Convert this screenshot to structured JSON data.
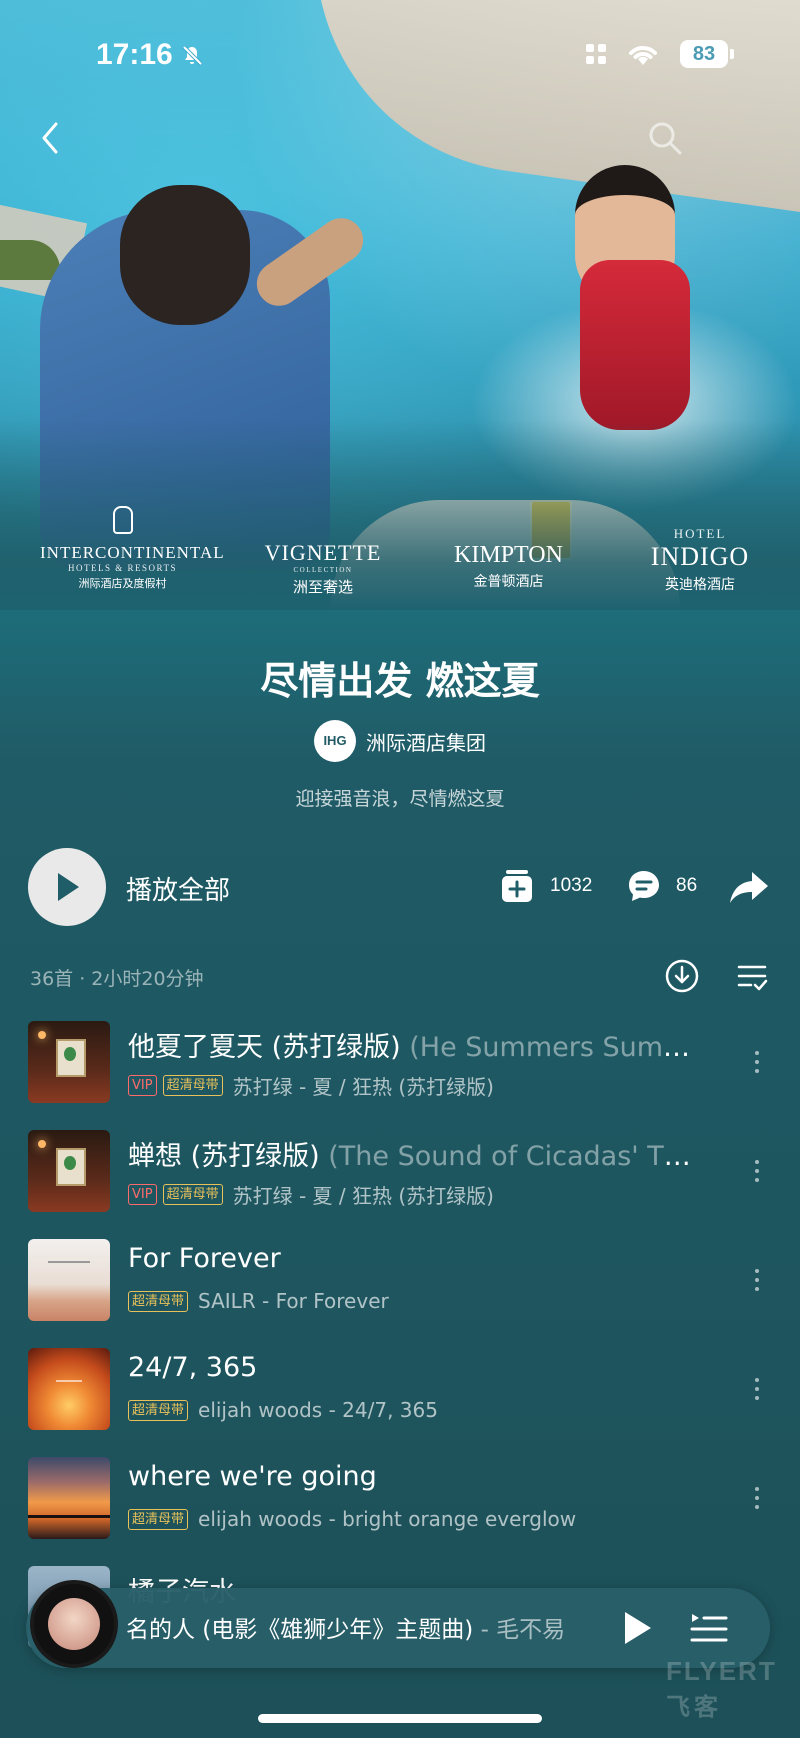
{
  "status_bar": {
    "time": "17:16",
    "battery": "83"
  },
  "hero": {
    "brands": [
      {
        "name": "INTERCONTINENTAL",
        "sub": "HOTELS & RESORTS",
        "cn": "洲际酒店及度假村"
      },
      {
        "name": "VIGNETTE",
        "sub": "COLLECTION",
        "cn": "洲至奢选"
      },
      {
        "name": "KIMPTON",
        "sub": "",
        "cn": "金普顿酒店"
      },
      {
        "name": "INDIGO",
        "sub": "HOTEL",
        "cn": "英迪格酒店"
      }
    ]
  },
  "playlist": {
    "title": "尽情出发 燃这夏",
    "publisher_logo": "IHG",
    "publisher": "洲际酒店集团",
    "description": "迎接强音浪，尽情燃这夏",
    "play_all": "播放全部",
    "collect_count": "1032",
    "comment_count": "86",
    "meta": "36首 · 2小时20分钟"
  },
  "songs": [
    {
      "title": "他夏了夏天 (苏打绿版)",
      "subtitle": " (He Summers Summers)",
      "vip": "VIP",
      "quality": "超清母带",
      "artist": "苏打绿 - 夏 / 狂热 (苏打绿版)"
    },
    {
      "title": "蝉想 (苏打绿版)",
      "subtitle": " (The Sound of Cicadas' Thoughts)",
      "vip": "VIP",
      "quality": "超清母带",
      "artist": "苏打绿 - 夏 / 狂热 (苏打绿版)"
    },
    {
      "title": "For Forever",
      "subtitle": "",
      "vip": "",
      "quality": "超清母带",
      "artist": "SAILR - For Forever"
    },
    {
      "title": "24/7, 365",
      "subtitle": "",
      "vip": "",
      "quality": "超清母带",
      "artist": "elijah woods - 24/7, 365"
    },
    {
      "title": "where we're going",
      "subtitle": "",
      "vip": "",
      "quality": "超清母带",
      "artist": "elijah woods - bright orange everglow"
    },
    {
      "title": "橘子汽水",
      "subtitle": "",
      "vip": "",
      "quality": "",
      "artist": ""
    }
  ],
  "now_playing": {
    "title": "名的人 (电影《雄狮少年》主题曲)",
    "artist": " - 毛不易"
  },
  "watermark": {
    "en": "FLYERT",
    "cn": "飞客"
  },
  "colors": {
    "background": "#1f5d68",
    "vip": "#ff6b6b",
    "quality": "#e8c15a"
  }
}
